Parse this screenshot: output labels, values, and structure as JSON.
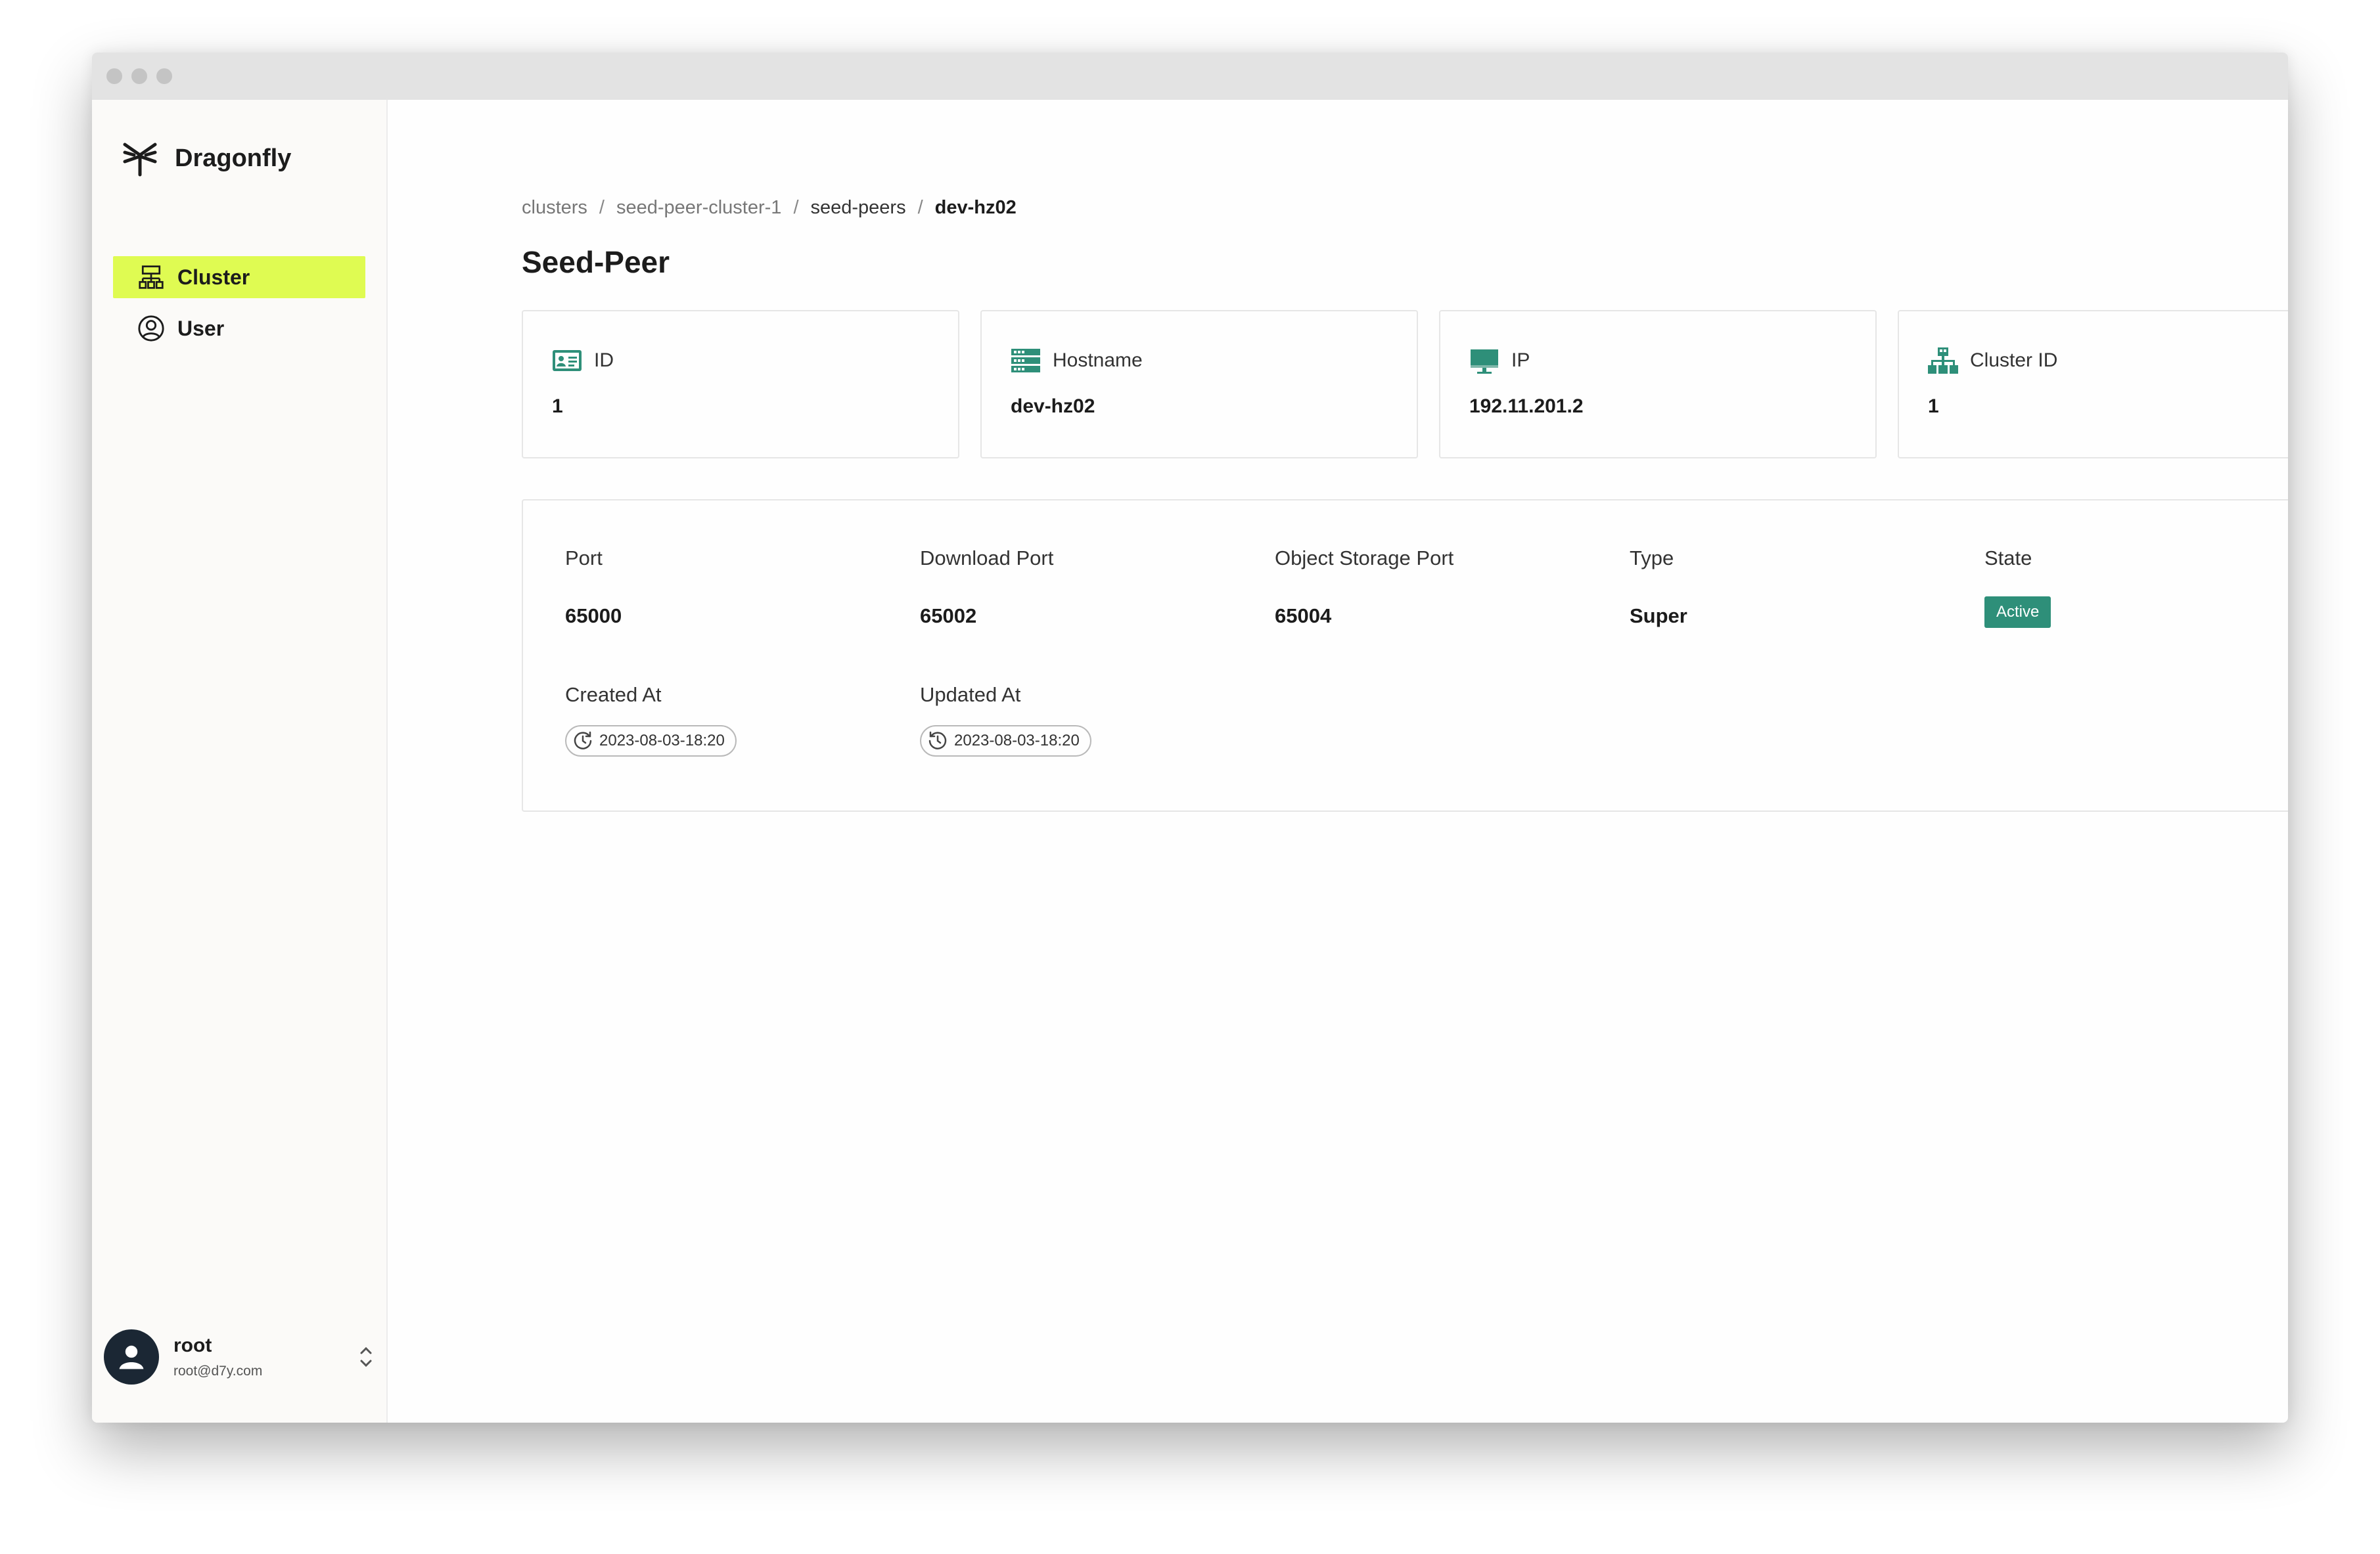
{
  "app": {
    "brand": "Dragonfly"
  },
  "sidebar": {
    "items": [
      {
        "label": "Cluster",
        "icon": "cluster-icon",
        "active": true
      },
      {
        "label": "User",
        "icon": "user-circle-icon",
        "active": false
      }
    ],
    "user": {
      "name": "root",
      "email": "root@d7y.com"
    }
  },
  "breadcrumb": {
    "items": [
      "clusters",
      "seed-peer-cluster-1",
      "seed-peers",
      "dev-hz02"
    ],
    "separator": "/"
  },
  "page": {
    "title": "Seed-Peer"
  },
  "cards": [
    {
      "label": "ID",
      "value": "1",
      "icon": "id-card-icon"
    },
    {
      "label": "Hostname",
      "value": "dev-hz02",
      "icon": "server-icon"
    },
    {
      "label": "IP",
      "value": "192.11.201.2",
      "icon": "monitor-icon"
    },
    {
      "label": "Cluster ID",
      "value": "1",
      "icon": "network-icon"
    }
  ],
  "details": {
    "port": {
      "label": "Port",
      "value": "65000"
    },
    "download_port": {
      "label": "Download Port",
      "value": "65002"
    },
    "object_storage_port": {
      "label": "Object Storage Port",
      "value": "65004"
    },
    "type": {
      "label": "Type",
      "value": "Super"
    },
    "state": {
      "label": "State",
      "value": "Active"
    },
    "created_at": {
      "label": "Created At",
      "value": "2023-08-03-18:20"
    },
    "updated_at": {
      "label": "Updated At",
      "value": "2023-08-03-18:20"
    }
  },
  "colors": {
    "accent_nav": "#dffb52",
    "icon_green": "#2e8f79",
    "badge_active": "#2e8f79",
    "avatar_bg": "#1b2734"
  }
}
